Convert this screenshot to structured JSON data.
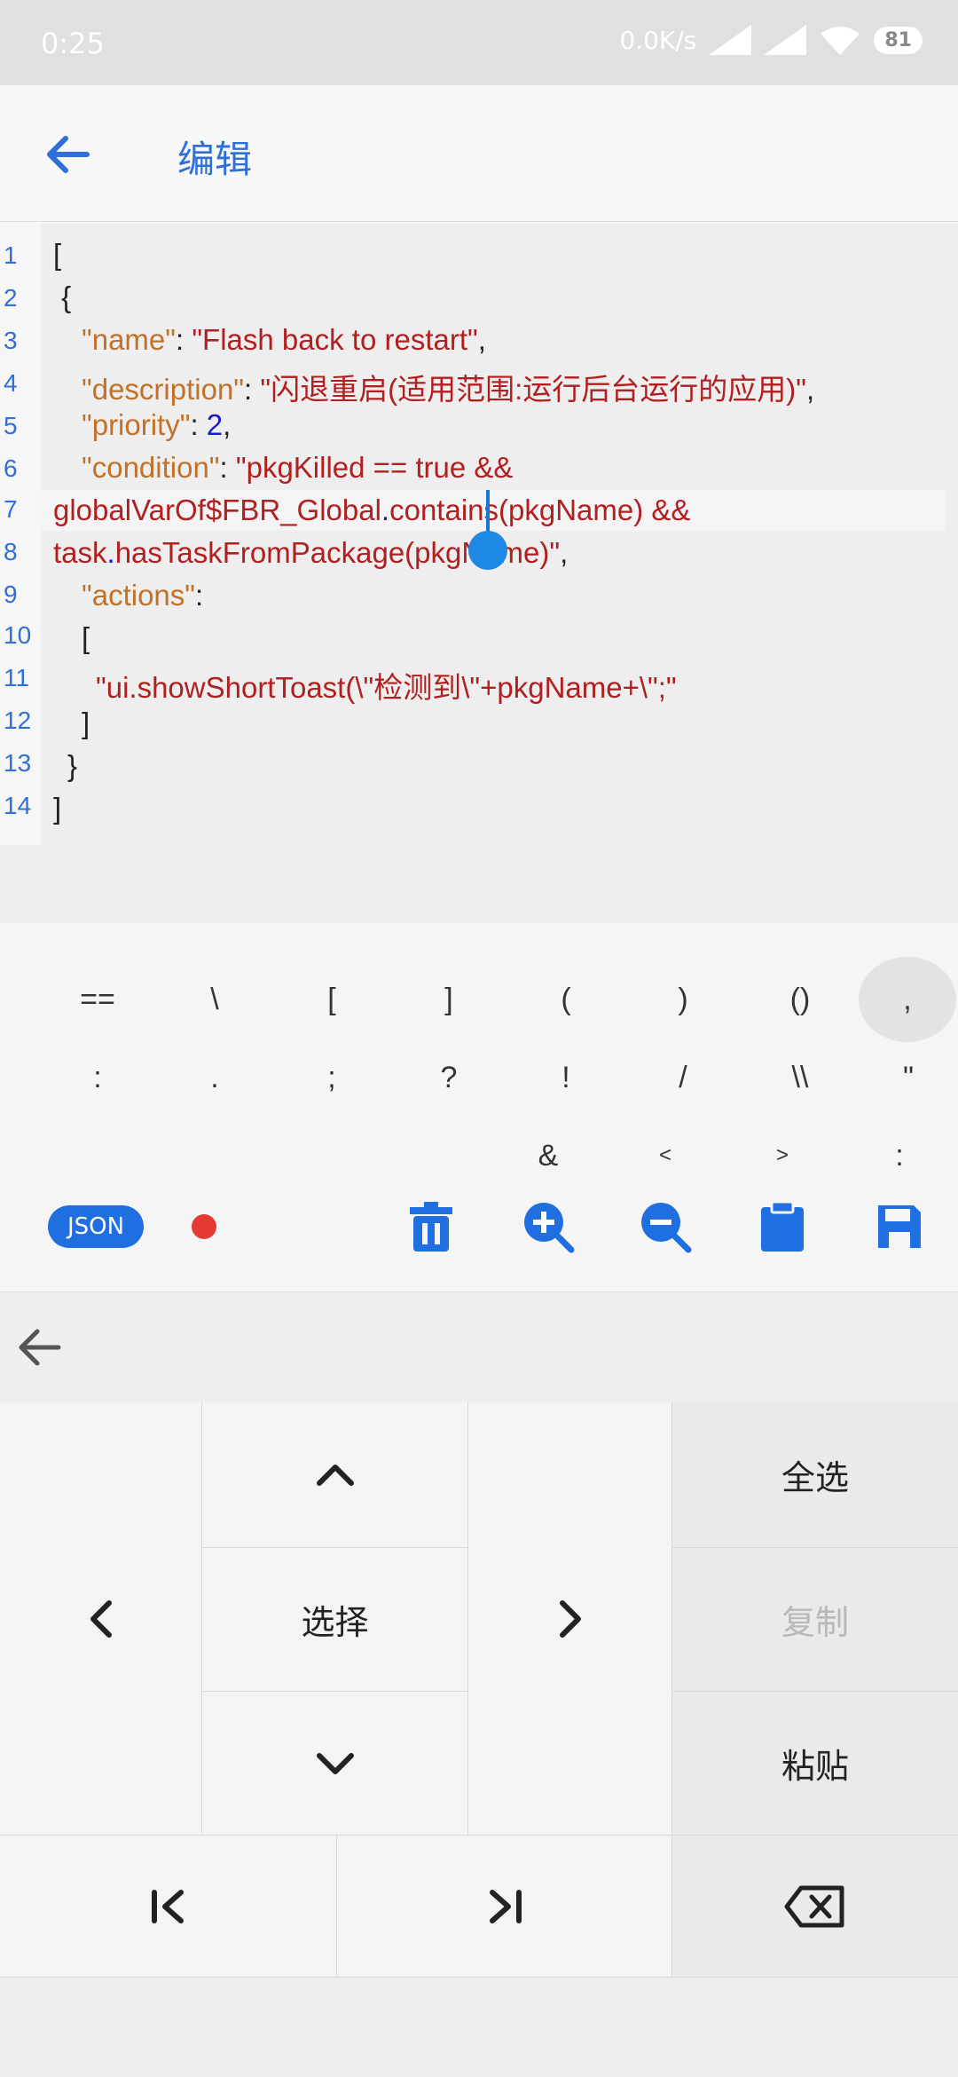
{
  "status_bar": {
    "time": "0:25",
    "speed": "0.0K/s",
    "battery": "81"
  },
  "app_bar": {
    "title": "编辑"
  },
  "editor": {
    "line_numbers": [
      "1",
      "2",
      "3",
      "4",
      "5",
      "6",
      "7",
      "8",
      "9",
      "10",
      "11",
      "12",
      "13",
      "14"
    ],
    "lines": {
      "l1": "[",
      "l2": " {",
      "l3_key": "\"name\"",
      "l3_colon": ": ",
      "l3_val": "\"Flash back to restart\"",
      "l3_end": ",",
      "l4_key": "\"description\"",
      "l4_colon": ": ",
      "l4_val": "\"闪退重启(适用范围:运行后台运行的应用)\"",
      "l4_end": ",",
      "l5_key": "\"priority\"",
      "l5_colon": ": ",
      "l5_val": "2",
      "l5_end": ",",
      "l6_key": "\"condition\"",
      "l6_colon": ": ",
      "l6_val": "\"pkgKilled == true &&",
      "l7_a": "globalVarOf$FBR_Global",
      "l7_dot": ".",
      "l7_b": "contains(pkgName) &&",
      "l8_a": "task",
      "l8_dot": ".",
      "l8_b": "hasTaskFromPackage(pkgName)\"",
      "l8_end": ",",
      "l9_key": "\"actions\"",
      "l9_colon": ":",
      "l10": "[",
      "l11": "\"ui.showShortToast(\\\"检测到\\\"+pkgName+\\\";\"",
      "l12": "]",
      "l13": "}",
      "l14": "]"
    }
  },
  "symbols": {
    "row1": [
      "==",
      "\\",
      "[",
      "]",
      "(",
      ")",
      "()",
      ","
    ],
    "row2": [
      ":",
      ".",
      ";",
      "?",
      "!",
      "/",
      "\\\\",
      "\""
    ],
    "row3": [
      "&",
      "<",
      ">",
      ":"
    ]
  },
  "toolbar": {
    "json_label": "JSON"
  },
  "keyboard": {
    "select_all": "全选",
    "select": "选择",
    "copy": "复制",
    "paste": "粘贴"
  },
  "colors": {
    "accent": "#2f6fd8",
    "key": "#c0712a",
    "string": "#b02020",
    "number": "#1a1acf"
  },
  "icons": [
    "back-arrow-icon",
    "delete-icon",
    "zoom-in-icon",
    "zoom-out-icon",
    "clipboard-icon",
    "save-icon",
    "backspace-icon"
  ]
}
